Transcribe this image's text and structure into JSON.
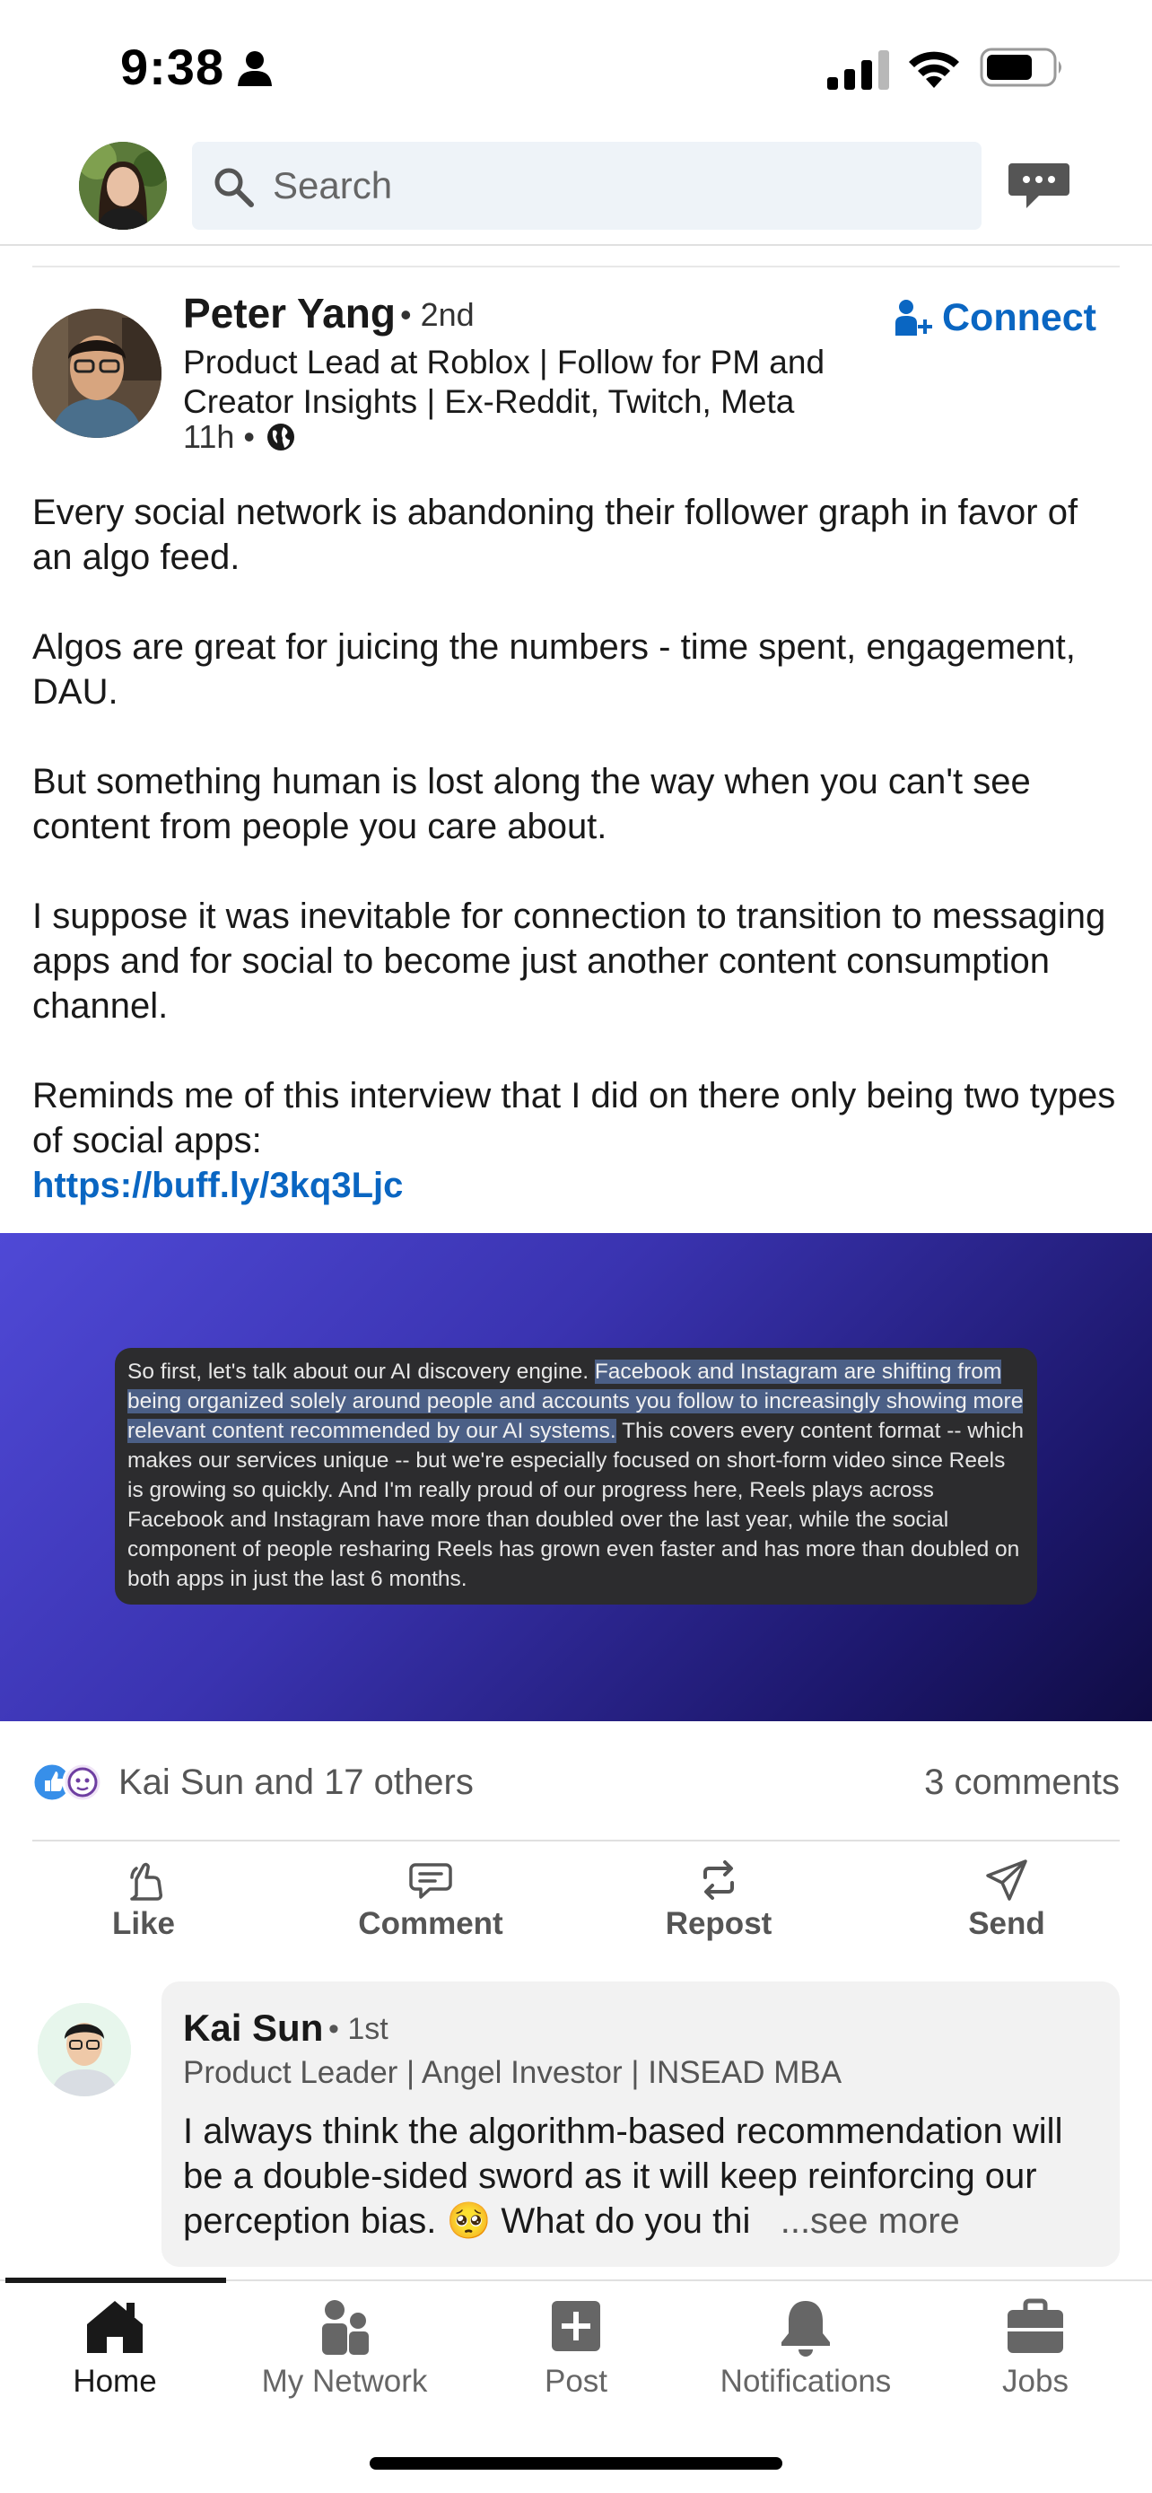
{
  "status_bar": {
    "time": "9:38"
  },
  "top_nav": {
    "search_placeholder": "Search"
  },
  "post": {
    "author": {
      "name": "Peter Yang",
      "degree": "• 2nd",
      "headline": "Product Lead at Roblox | Follow for PM and Creator Insights | Ex-Reddit, Twitch, Meta",
      "time": "11h •"
    },
    "connect_label": "Connect",
    "body": [
      "Every social network is abandoning their follower graph in favor of an algo feed.",
      "Algos are great for juicing the numbers - time spent, engagement, DAU.",
      "But something human is lost along the way when you can't see content from people you care about.",
      "I suppose it was inevitable for connection to transition to messaging apps and for social to become just another content consumption channel.",
      "Reminds me of this interview that I did on there only being two types of social apps:"
    ],
    "link": "https://buff.ly/3kq3Ljc",
    "image_quote": {
      "before": "So first, let's talk about our AI discovery engine. ",
      "highlight": "Facebook and Instagram are shifting from being organized solely around people and accounts you follow to increasingly showing more relevant content recommended by our AI systems.",
      "after": " This covers every content format -- which makes our services unique -- but we're especially focused on short-form video since Reels is growing so quickly. And I'm really proud of our progress here, Reels plays across Facebook and Instagram have more than doubled over the last year, while the social component of people resharing Reels has grown even faster and has more than doubled on both apps in just the last 6 months."
    },
    "reactions_text": "Kai Sun and 17 others",
    "comments_count": "3 comments",
    "actions": {
      "like": "Like",
      "comment": "Comment",
      "repost": "Repost",
      "send": "Send"
    }
  },
  "comment": {
    "name": "Kai Sun",
    "degree": "• 1st",
    "headline": "Product Leader | Angel Investor | INSEAD MBA",
    "text_line1": "I always think the algorithm-based recommendation will be a double-sided sword as it will keep reinforcing our perception bias. 🥺  What do you thi",
    "see_more": "...see more"
  },
  "bottom_nav": {
    "home": "Home",
    "my_network": "My Network",
    "post": "Post",
    "notifications": "Notifications",
    "jobs": "Jobs"
  },
  "colors": {
    "brand_blue": "#0a66c2",
    "text_primary": "#191919",
    "text_secondary": "#666666"
  }
}
